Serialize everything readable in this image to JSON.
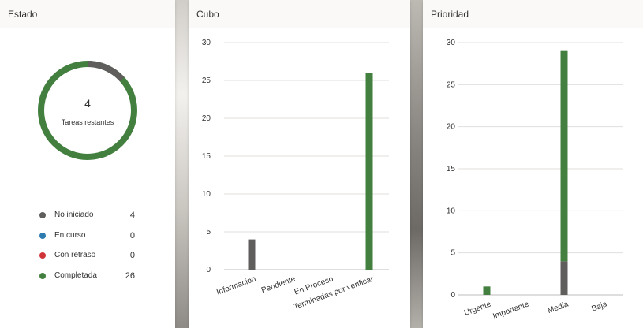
{
  "estado": {
    "title": "Estado",
    "remaining_count": "4",
    "remaining_label": "Tareas restantes",
    "donut_fraction_not_started": 0.1333,
    "legend": [
      {
        "label": "No iniciado",
        "count": "4",
        "color": "#605e5c"
      },
      {
        "label": "En curso",
        "count": "0",
        "color": "#2e7bb0"
      },
      {
        "label": "Con retraso",
        "count": "0",
        "color": "#d13438"
      },
      {
        "label": "Completada",
        "count": "26",
        "color": "#43803f"
      }
    ]
  },
  "cubo": {
    "title": "Cubo"
  },
  "prioridad": {
    "title": "Prioridad"
  },
  "chart_data": [
    {
      "type": "bar",
      "title": "Cubo",
      "categories": [
        "Informacion",
        "Pendiente",
        "En Proceso",
        "Terminadas por verificar"
      ],
      "series": [
        {
          "values": [
            4,
            0,
            0,
            0
          ],
          "color": "#605e5c"
        },
        {
          "values": [
            0,
            0,
            0,
            26
          ],
          "color": "#43803f"
        }
      ],
      "ylim": [
        0,
        30
      ],
      "yticks": [
        0,
        5,
        10,
        15,
        20,
        25,
        30
      ],
      "grid": true,
      "stacked": true
    },
    {
      "type": "bar",
      "title": "Prioridad",
      "categories": [
        "Urgente",
        "Importante",
        "Media",
        "Baja"
      ],
      "series": [
        {
          "values": [
            0,
            0,
            4,
            0
          ],
          "color": "#605e5c"
        },
        {
          "values": [
            1,
            0,
            25,
            0
          ],
          "color": "#43803f"
        }
      ],
      "ylim": [
        0,
        30
      ],
      "yticks": [
        0,
        5,
        10,
        15,
        20,
        25,
        30
      ],
      "grid": true,
      "stacked": true
    }
  ]
}
